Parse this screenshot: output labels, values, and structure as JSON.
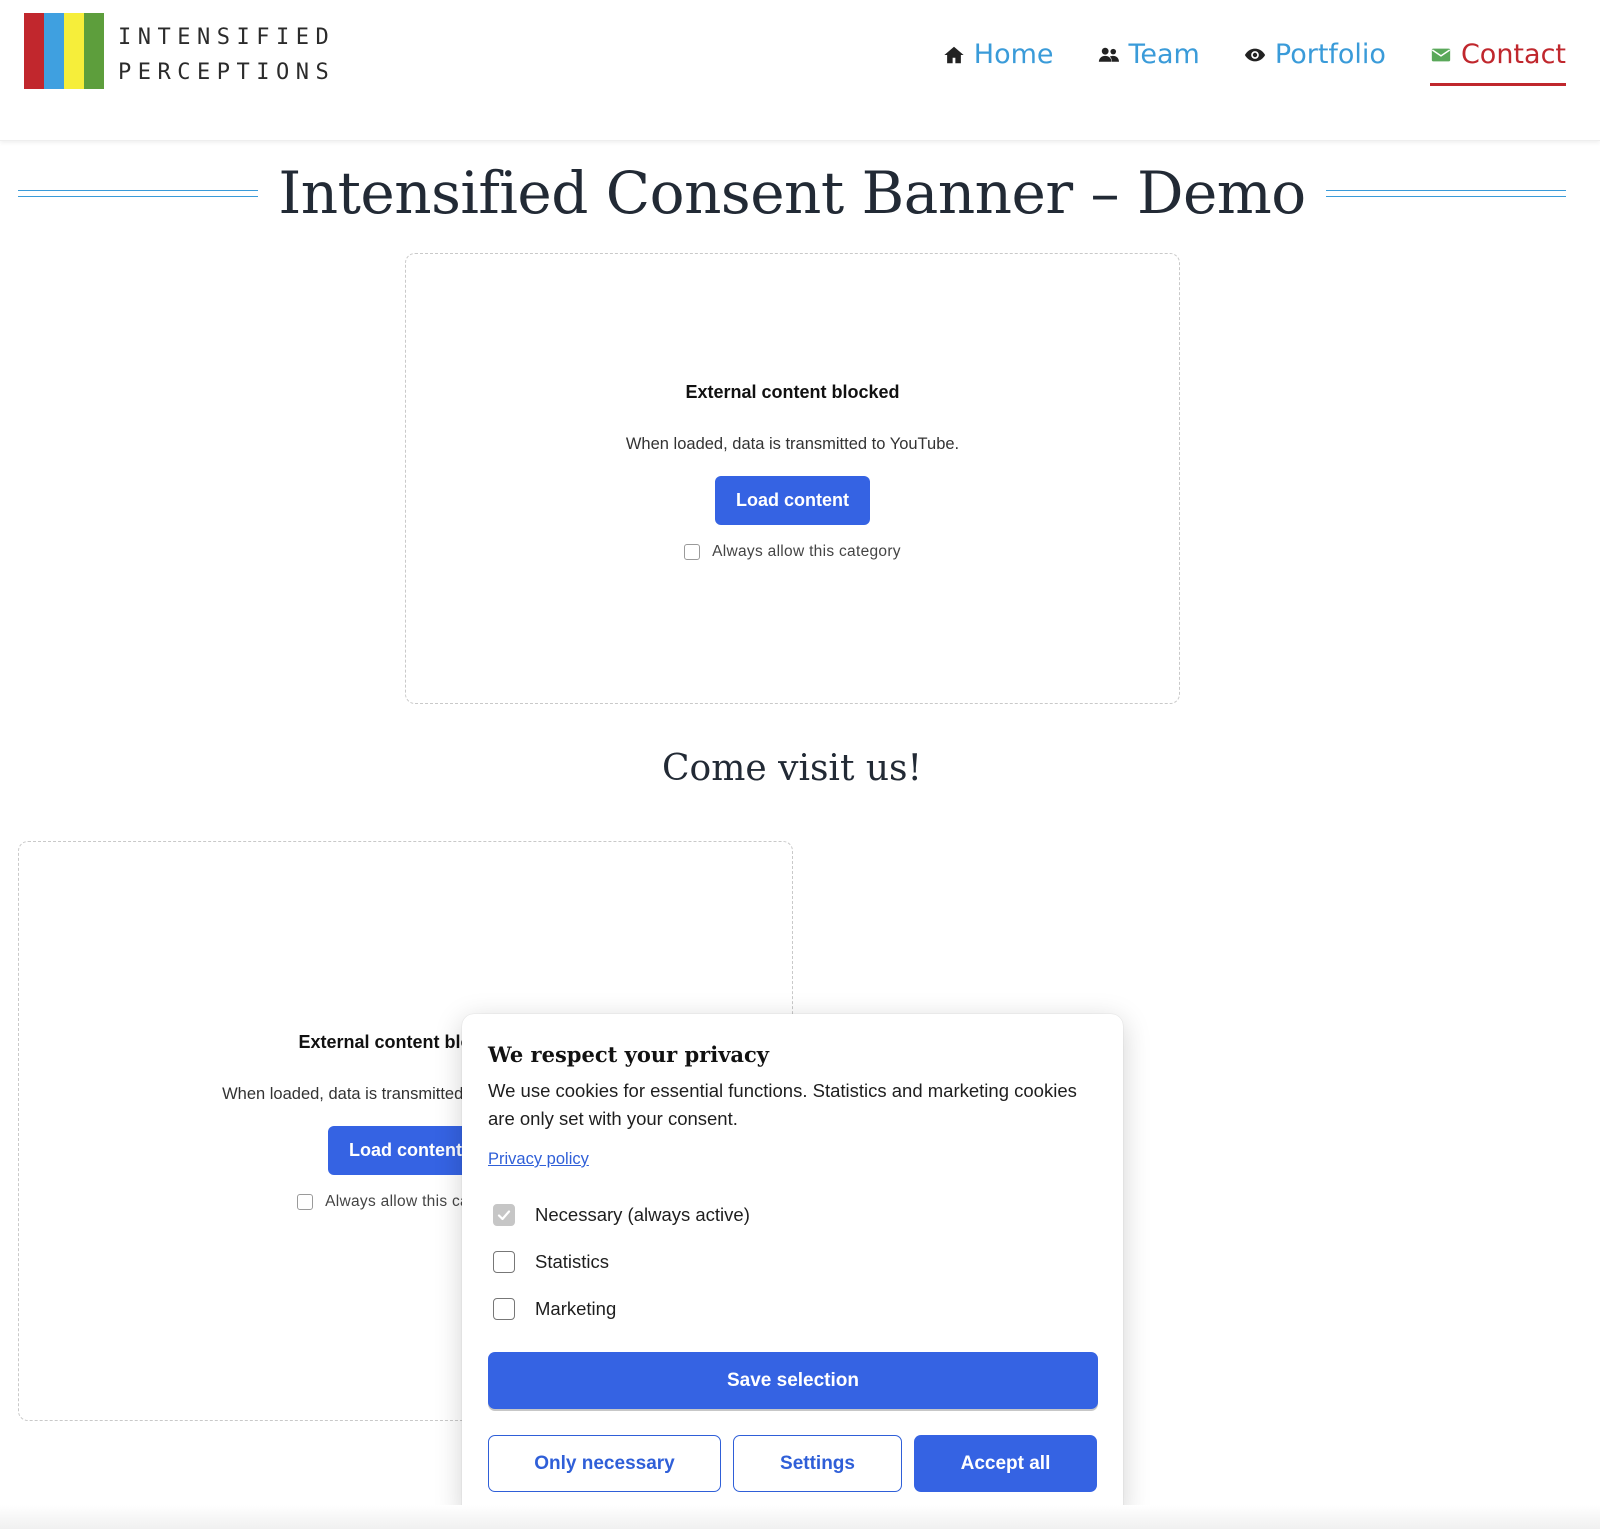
{
  "brand": {
    "line1": "INTENSIFIED",
    "line2": "PERCEPTIONS",
    "stripe_colors": [
      "#c1272d",
      "#3fa0e0",
      "#f6ee3a",
      "#5d9e3c"
    ]
  },
  "nav": {
    "items": [
      {
        "label": "Home",
        "icon": "home-icon"
      },
      {
        "label": "Team",
        "icon": "users-icon"
      },
      {
        "label": "Portfolio",
        "icon": "eye-icon"
      },
      {
        "label": "Contact",
        "icon": "envelope-icon",
        "active": true
      }
    ]
  },
  "page": {
    "title": "Intensified Consent Banner – Demo",
    "section_heading": "Come visit us!"
  },
  "blocked": {
    "title": "External content blocked",
    "description": "When loaded, data is transmitted to YouTube.",
    "load_label": "Load content",
    "always_allow_label": "Always allow this category"
  },
  "blocked2": {
    "title": "External content blocked",
    "description": "When loaded, data is transmitted to Google Maps.",
    "load_label": "Load content",
    "always_allow_label": "Always allow this category"
  },
  "consent": {
    "title": "We respect your privacy",
    "text": "We use cookies for essential functions. Statistics and marketing cookies are only set with your consent.",
    "privacy_link": "Privacy policy",
    "options": [
      {
        "label": "Necessary (always active)",
        "checked": true,
        "disabled": true
      },
      {
        "label": "Statistics",
        "checked": false
      },
      {
        "label": "Marketing",
        "checked": false
      }
    ],
    "save_label": "Save selection",
    "only_necessary_label": "Only necessary",
    "settings_label": "Settings",
    "accept_all_label": "Accept all"
  },
  "colors": {
    "accent": "#3563e3",
    "nav_link": "#3a9bd9",
    "nav_active": "#c0272d",
    "contact_icon": "#5aa85a"
  }
}
